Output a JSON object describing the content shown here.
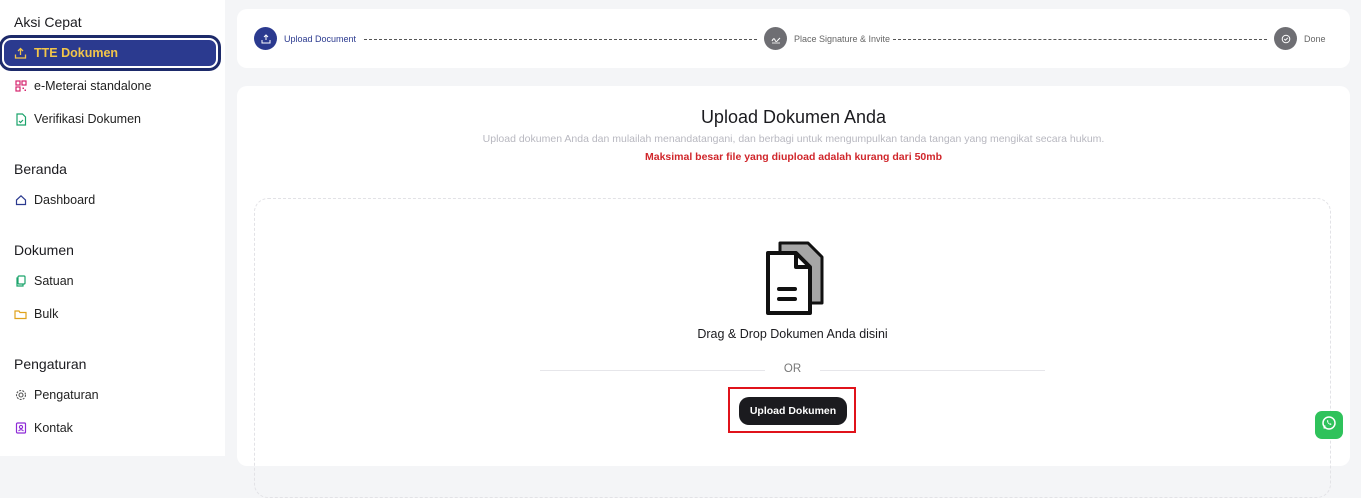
{
  "sidebar": {
    "sections": [
      {
        "title": "Aksi Cepat",
        "items": [
          {
            "label": "TTE Dokumen",
            "icon": "upload-tray-icon"
          },
          {
            "label": "e-Meterai standalone",
            "icon": "qr-code-icon"
          },
          {
            "label": "Verifikasi Dokumen",
            "icon": "file-check-icon"
          }
        ]
      },
      {
        "title": "Beranda",
        "items": [
          {
            "label": "Dashboard",
            "icon": "home-icon"
          }
        ]
      },
      {
        "title": "Dokumen",
        "items": [
          {
            "label": "Satuan",
            "icon": "file-copy-icon"
          },
          {
            "label": "Bulk",
            "icon": "folder-icon"
          }
        ]
      },
      {
        "title": "Pengaturan",
        "items": [
          {
            "label": "Pengaturan",
            "icon": "gear-icon"
          },
          {
            "label": "Kontak",
            "icon": "contact-book-icon"
          }
        ]
      }
    ]
  },
  "stepper": {
    "steps": [
      {
        "label": "Upload Document",
        "state": "active"
      },
      {
        "label": "Place Signature & Invite",
        "state": "inactive"
      },
      {
        "label": "Done",
        "state": "inactive"
      }
    ]
  },
  "upload": {
    "title": "Upload Dokumen Anda",
    "subtitle": "Upload dokumen Anda dan mulailah menandatangani, dan berbagi untuk mengumpulkan tanda tangan yang mengikat secara hukum.",
    "warning": "Maksimal besar file yang diupload adalah kurang dari 50mb",
    "drag_text": "Drag & Drop Dokumen Anda disini",
    "or_text": "OR",
    "button_label": "Upload Dokumen"
  },
  "colors": {
    "primary": "#2b3a8f",
    "accent": "#f3c64a",
    "warning": "#d0262b",
    "whatsapp": "#2fc25b"
  }
}
